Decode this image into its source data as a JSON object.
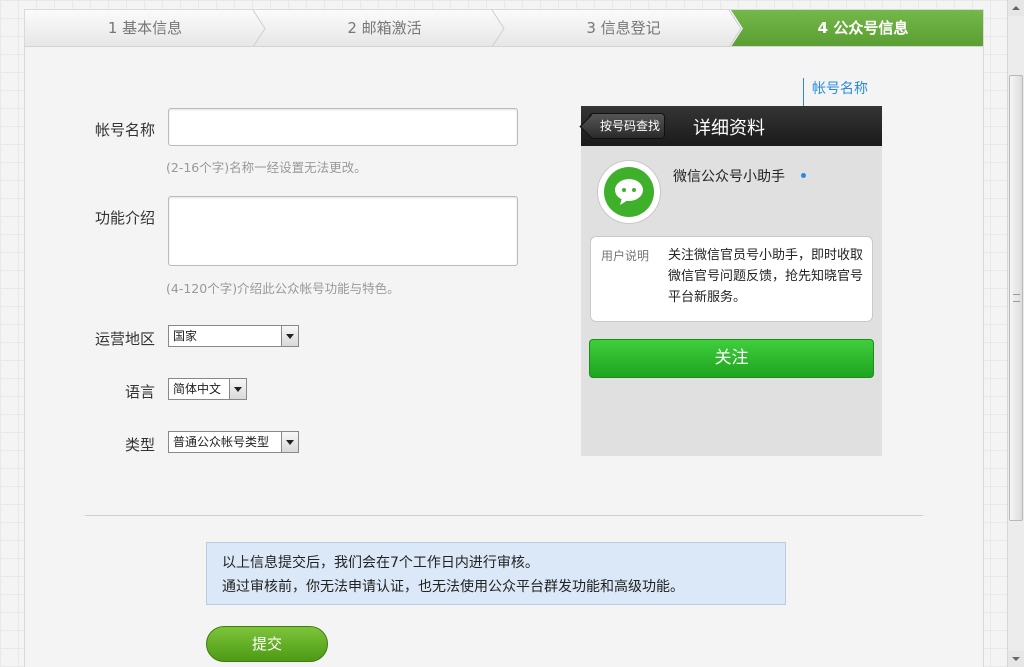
{
  "steps": [
    {
      "label": "1 基本信息"
    },
    {
      "label": "2 邮箱激活"
    },
    {
      "label": "3 信息登记"
    },
    {
      "label": "4 公众号信息"
    }
  ],
  "colors": {
    "active_step": "#6aac3f",
    "link_blue": "#2a8ae0",
    "follow_green": "#2db82d"
  },
  "form": {
    "account_name_label": "帐号名称",
    "account_name_value": "",
    "account_name_hint": "(2-16个字)名称一经设置无法更改。",
    "intro_label": "功能介绍",
    "intro_value": "",
    "intro_hint": "(4-120个字)介绍此公众帐号功能与特色。",
    "region_label": "运营地区",
    "region_value": "国家",
    "language_label": "语言",
    "language_value": "简体中文",
    "type_label": "类型",
    "type_value": "普通公众帐号类型"
  },
  "preview": {
    "back_button": "按号码查找",
    "title": "详细资料",
    "account_name": "微信公众号小助手",
    "desc_label": "用户说明",
    "desc_text": "关注微信官员号小助手，即时收取微信官号问题反馈，抢先知晓官号平台新服务。",
    "follow_button": "关注",
    "annotation": "帐号名称"
  },
  "notice": {
    "line1": "以上信息提交后，我们会在7个工作日内进行审核。",
    "line2": "通过审核前，你无法申请认证，也无法使用公众平台群发功能和高级功能。"
  },
  "submit_button": "提交"
}
